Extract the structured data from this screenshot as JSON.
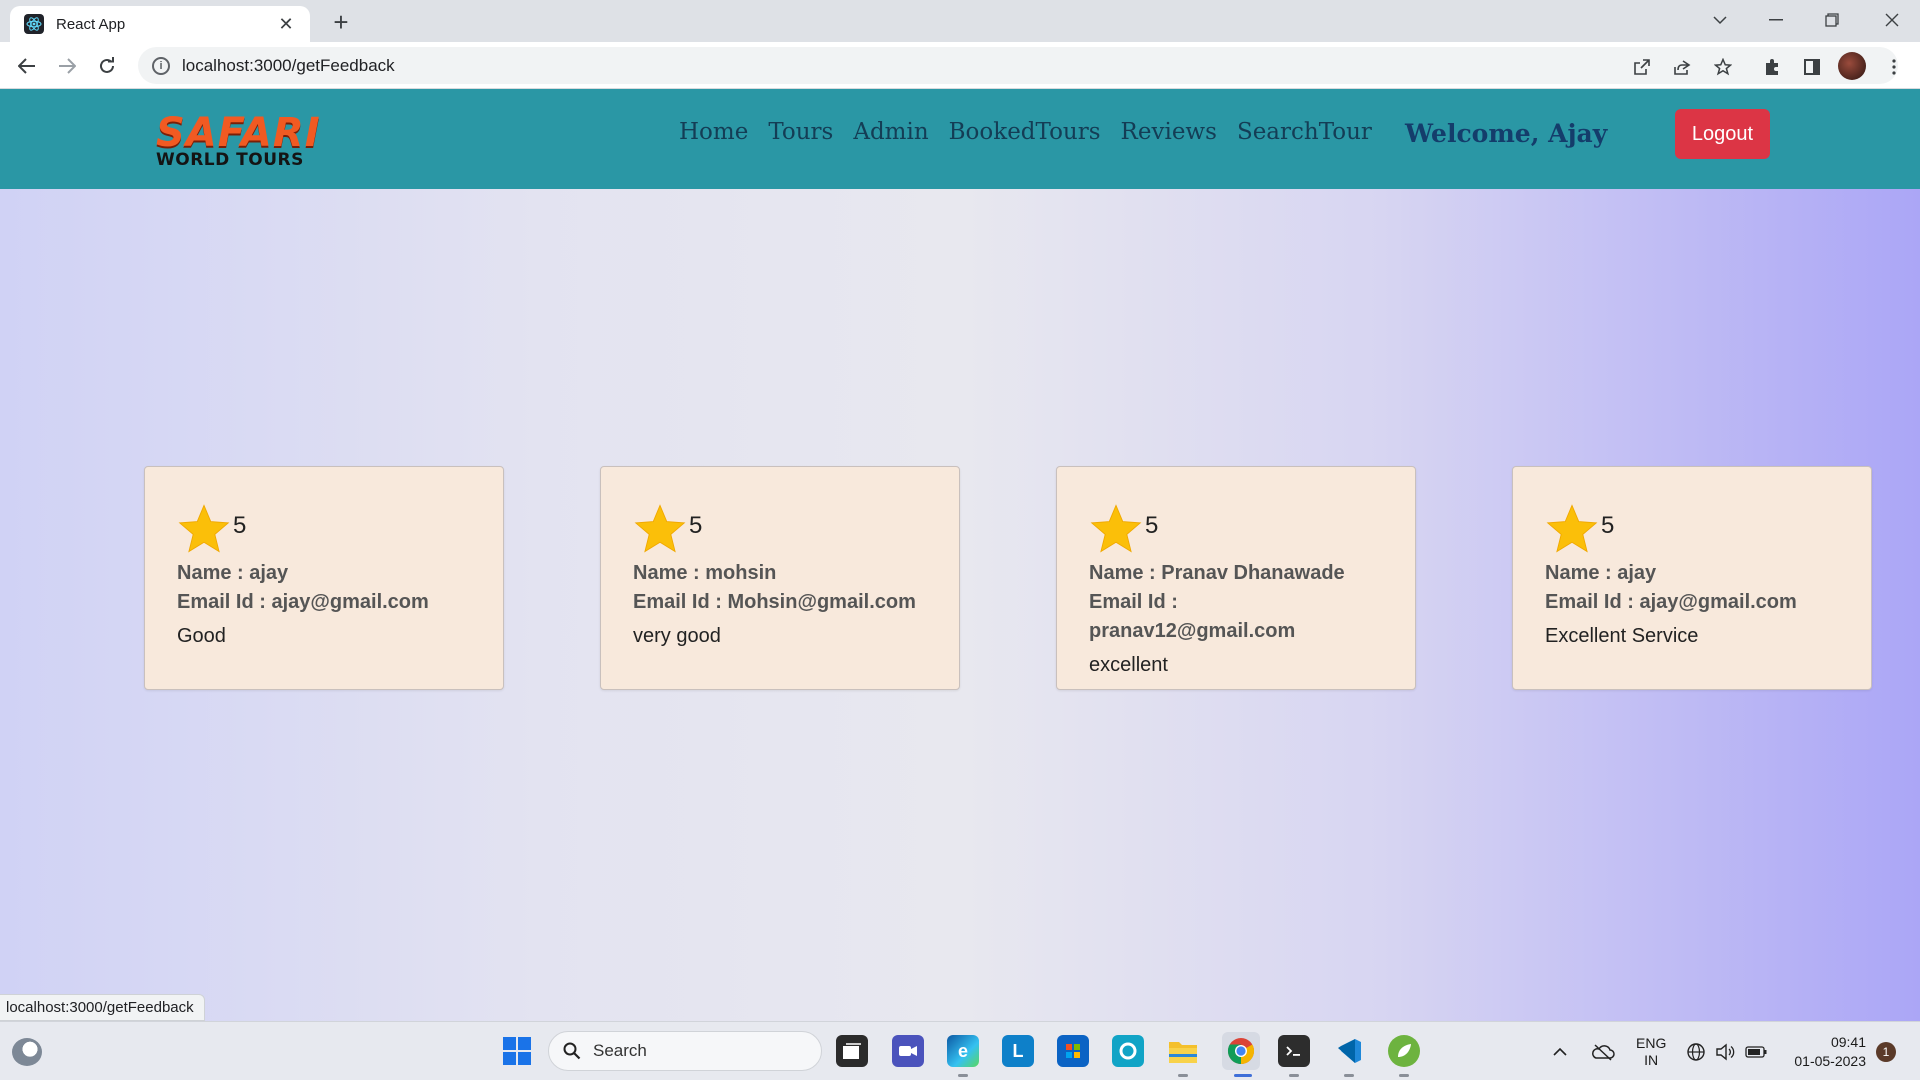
{
  "browser": {
    "tab_title": "React App",
    "url": "localhost:3000/getFeedback",
    "status_url": "localhost:3000/getFeedback"
  },
  "app": {
    "logo_top": "SAFARI",
    "logo_bottom": "WORLD TOURS",
    "nav": [
      "Home",
      "Tours",
      "Admin",
      "BookedTours",
      "Reviews",
      "SearchTour"
    ],
    "welcome": "Welcome, Ajay",
    "logout_label": "Logout"
  },
  "feedback": [
    {
      "rating": "5",
      "name": "Name : ajay",
      "email": "Email Id : ajay@gmail.com",
      "comment": "Good"
    },
    {
      "rating": "5",
      "name": "Name : mohsin",
      "email": "Email Id : Mohsin@gmail.com",
      "comment": "very good"
    },
    {
      "rating": "5",
      "name": "Name : Pranav Dhanawade",
      "email": "Email Id : pranav12@gmail.com",
      "comment": "excellent"
    },
    {
      "rating": "5",
      "name": "Name : ajay",
      "email": "Email Id : ajay@gmail.com",
      "comment": "Excellent Service"
    }
  ],
  "taskbar": {
    "search_label": "Search",
    "lang_top": "ENG",
    "lang_bottom": "IN",
    "time": "09:41",
    "date": "01-05-2023",
    "notification_count": "1"
  },
  "colors": {
    "navbar": "#2a97a5",
    "logout": "#dc3545",
    "card_bg": "#f8e9dc",
    "star": "#fbbf09"
  }
}
